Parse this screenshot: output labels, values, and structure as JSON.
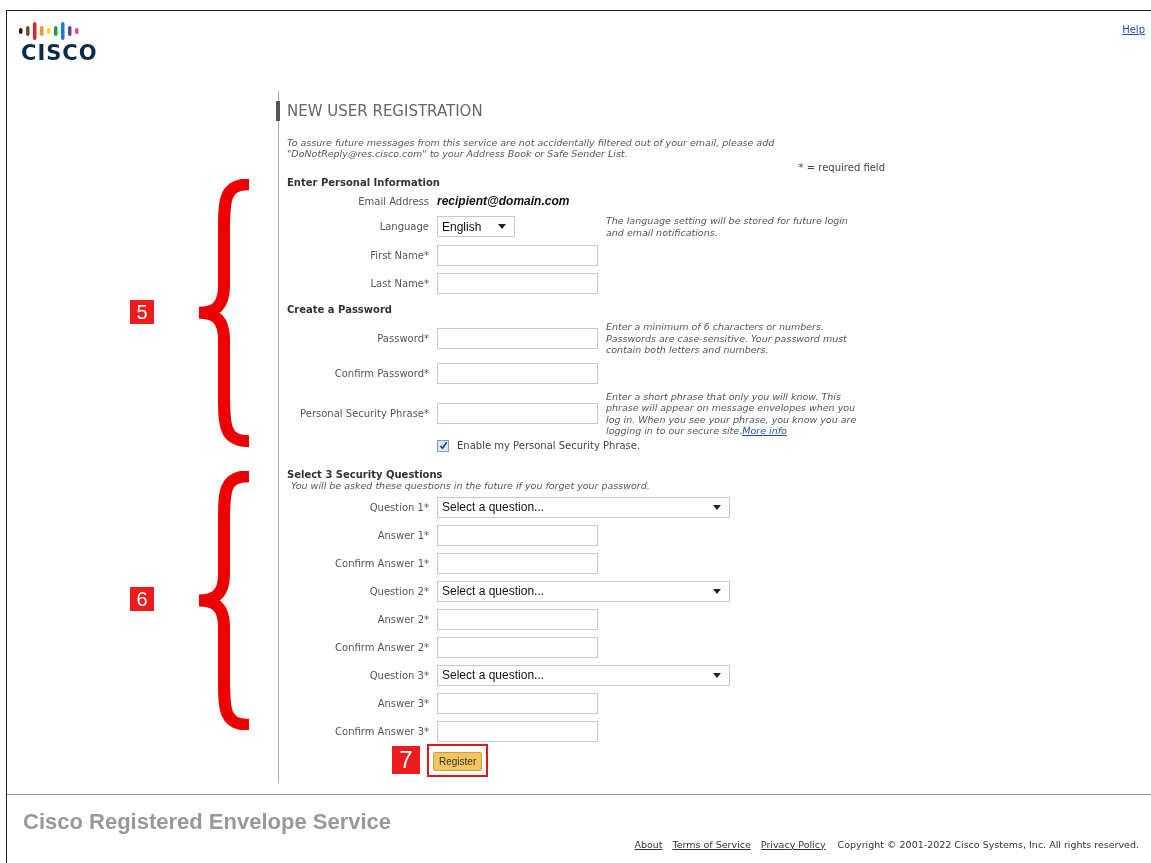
{
  "header": {
    "logo_text": "CISCO",
    "help": "Help"
  },
  "title": "NEW USER REGISTRATION",
  "notice": "To assure future messages from this service are not accidentally filtered out of your email, please add\n\"DoNotReply@res.cisco.com\" to your Address Book or Safe Sender List.",
  "required_note": "* = required field",
  "groups": [
    {
      "callout": "5",
      "sections": [
        {
          "heading": "Enter Personal Information",
          "rows": [
            {
              "kind": "static",
              "label": "Email Address",
              "value": "recipient@domain.com"
            },
            {
              "kind": "select",
              "label": "Language",
              "value": "English",
              "hint": "The language setting will be stored for future login\nand email notifications."
            },
            {
              "kind": "text",
              "label": "First Name*"
            },
            {
              "kind": "text",
              "label": "Last Name*"
            }
          ]
        },
        {
          "heading": "Create a Password",
          "rows": [
            {
              "kind": "text",
              "label": "Password*",
              "hint": "Enter a minimum of 6 characters or numbers.\nPasswords are case-sensitive. Your password must\ncontain both letters and numbers."
            },
            {
              "kind": "text",
              "label": "Confirm Password*"
            },
            {
              "kind": "text",
              "label": "Personal Security Phrase*",
              "hint": "Enter a short phrase that only you will know. This\nphrase will appear on message envelopes when you\nlog in. When you see your phrase, you know you are\nlogging in to our secure site.",
              "hint_link": "More info"
            },
            {
              "kind": "checkbox",
              "label": "Enable my Personal Security Phrase.",
              "checked": true
            }
          ]
        }
      ]
    },
    {
      "callout": "6",
      "sections": [
        {
          "heading": "Select 3 Security Questions",
          "note": "You will be asked these questions in the future if you forget your password.",
          "rows": [
            {
              "kind": "question",
              "label": "Question 1*",
              "value": "Select a question..."
            },
            {
              "kind": "text",
              "label": "Answer 1*"
            },
            {
              "kind": "text",
              "label": "Confirm Answer 1*"
            },
            {
              "kind": "question",
              "label": "Question 2*",
              "value": "Select a question..."
            },
            {
              "kind": "text",
              "label": "Answer 2*"
            },
            {
              "kind": "text",
              "label": "Confirm Answer 2*"
            },
            {
              "kind": "question",
              "label": "Question 3*",
              "value": "Select a question..."
            },
            {
              "kind": "text",
              "label": "Answer 3*"
            },
            {
              "kind": "text",
              "label": "Confirm Answer 3*"
            }
          ]
        }
      ]
    }
  ],
  "register": {
    "label": "Register",
    "callout": "7"
  },
  "footer": {
    "brand": "Cisco Registered Envelope Service",
    "links": [
      "About",
      "Terms of Service",
      "Privacy Policy"
    ],
    "copyright": "Copyright © 2001-2022 Cisco Systems, Inc. All rights reserved."
  }
}
